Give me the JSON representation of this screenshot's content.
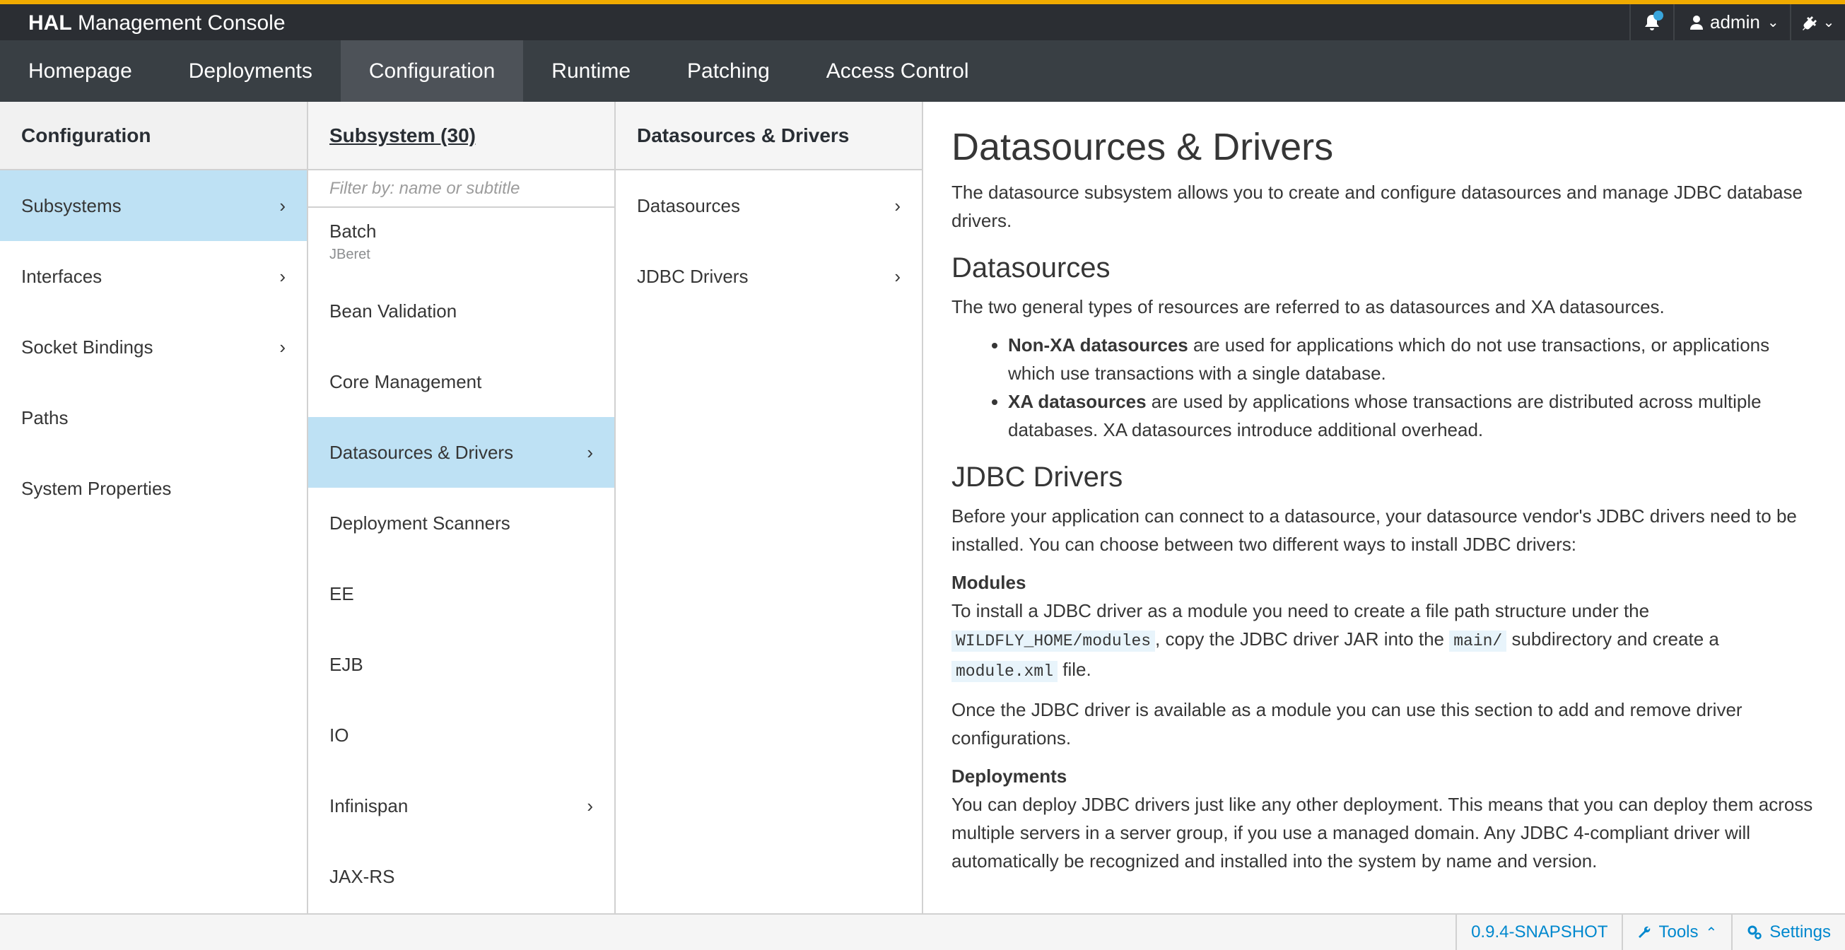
{
  "header": {
    "brand_bold": "HAL",
    "brand_rest": "Management Console",
    "user": "admin",
    "icons": [
      "bell-icon",
      "user-icon",
      "plug-icon"
    ]
  },
  "nav": {
    "items": [
      "Homepage",
      "Deployments",
      "Configuration",
      "Runtime",
      "Patching",
      "Access Control"
    ],
    "active": "Configuration"
  },
  "col1": {
    "title": "Configuration",
    "items": [
      {
        "label": "Subsystems",
        "active": true,
        "arrow": true
      },
      {
        "label": "Interfaces",
        "arrow": true
      },
      {
        "label": "Socket Bindings",
        "arrow": true
      },
      {
        "label": "Paths"
      },
      {
        "label": "System Properties"
      }
    ]
  },
  "col2": {
    "title": "Subsystem (30)",
    "filter_placeholder": "Filter by: name or subtitle",
    "items": [
      {
        "label": "Batch",
        "subtitle": "JBeret"
      },
      {
        "label": "Bean Validation"
      },
      {
        "label": "Core Management"
      },
      {
        "label": "Datasources & Drivers",
        "active": true,
        "arrow": true
      },
      {
        "label": "Deployment Scanners"
      },
      {
        "label": "EE"
      },
      {
        "label": "EJB"
      },
      {
        "label": "IO"
      },
      {
        "label": "Infinispan",
        "arrow": true
      },
      {
        "label": "JAX-RS"
      }
    ]
  },
  "col3": {
    "title": "Datasources & Drivers",
    "items": [
      {
        "label": "Datasources",
        "arrow": true
      },
      {
        "label": "JDBC Drivers",
        "arrow": true
      }
    ]
  },
  "content": {
    "title": "Datasources & Drivers",
    "intro": "The datasource subsystem allows you to create and configure datasources and manage JDBC database drivers.",
    "ds_heading": "Datasources",
    "ds_text": "The two general types of resources are referred to as datasources and XA datasources.",
    "bullet1_bold": "Non-XA datasources",
    "bullet1_text": " are used for applications which do not use transactions, or applications which use transactions with a single database.",
    "bullet2_bold": "XA datasources",
    "bullet2_text": " are used by applications whose transactions are distributed across multiple databases. XA datasources introduce additional overhead.",
    "jdbc_heading": "JDBC Drivers",
    "jdbc_text": "Before your application can connect to a datasource, your datasource vendor's JDBC drivers need to be installed. You can choose between two different ways to install JDBC drivers:",
    "modules_heading": "Modules",
    "modules_text_1": "To install a JDBC driver as a module you need to create a file path structure under the ",
    "modules_code_1": "WILDFLY_HOME/modules",
    "modules_text_2": ", copy the JDBC driver JAR into the ",
    "modules_code_2": "main/",
    "modules_text_3": " subdirectory and create a ",
    "modules_code_3": "module.xml",
    "modules_text_4": " file.",
    "modules_text_5": "Once the JDBC driver is available as a module you can use this section to add and remove driver configurations.",
    "deployments_heading": "Deployments",
    "deployments_text": "You can deploy JDBC drivers just like any other deployment. This means that you can deploy them across multiple servers in a server group, if you use a managed domain. Any JDBC 4-compliant driver will automatically be recognized and installed into the system by name and version."
  },
  "footer": {
    "version": "0.9.4-SNAPSHOT",
    "tools": "Tools",
    "settings": "Settings"
  },
  "colors": {
    "accent": "#f0ab00",
    "topbar": "#2b2e33",
    "nav": "#393f44",
    "nav_active": "#4d5258",
    "selected": "#bee1f4",
    "link": "#0088ce"
  }
}
